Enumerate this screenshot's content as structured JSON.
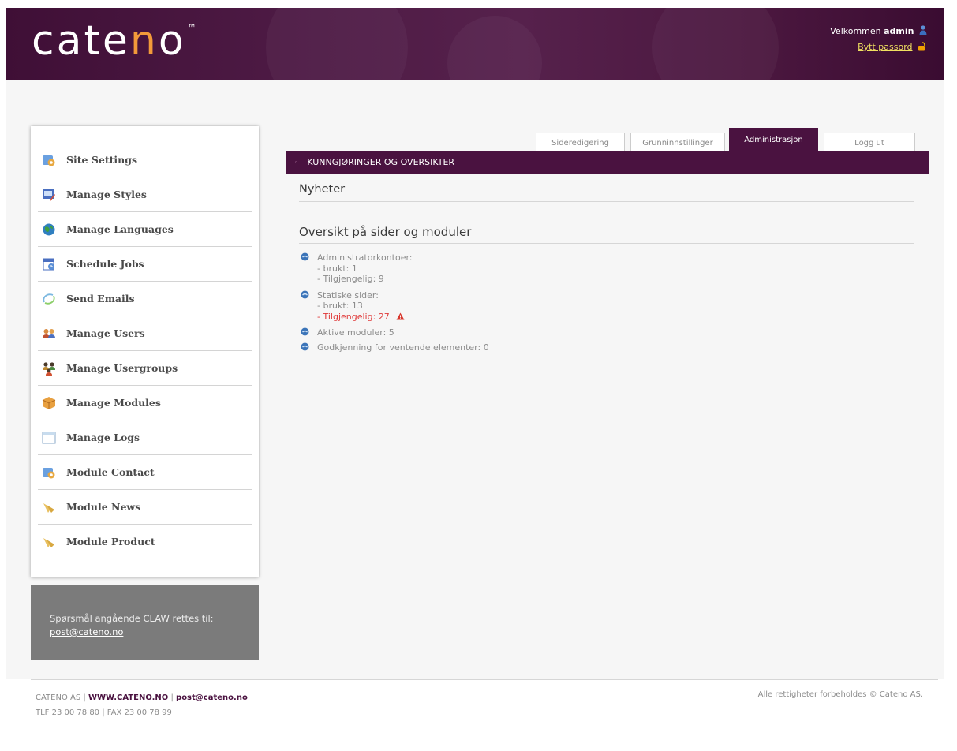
{
  "header": {
    "logo_text": "cateno",
    "logo_tm": "™",
    "welcome_prefix": "Velkommen",
    "username": "admin",
    "change_password": "Bytt passord"
  },
  "sidebar": {
    "items": [
      {
        "label": "Site Settings",
        "icon": "site-settings-icon"
      },
      {
        "label": "Manage Styles",
        "icon": "styles-icon"
      },
      {
        "label": "Manage Languages",
        "icon": "globe-icon"
      },
      {
        "label": "Schedule Jobs",
        "icon": "schedule-icon"
      },
      {
        "label": "Send Emails",
        "icon": "email-icon"
      },
      {
        "label": "Manage Users",
        "icon": "users-icon"
      },
      {
        "label": "Manage Usergroups",
        "icon": "usergroups-icon"
      },
      {
        "label": "Manage Modules",
        "icon": "modules-icon"
      },
      {
        "label": "Manage Logs",
        "icon": "logs-icon"
      },
      {
        "label": "Module Contact",
        "icon": "contact-icon"
      },
      {
        "label": "Module News",
        "icon": "news-icon"
      },
      {
        "label": "Module Product",
        "icon": "product-icon"
      }
    ]
  },
  "info_box": {
    "text": "Spørsmål angående CLAW rettes til:",
    "email": "post@cateno.no"
  },
  "tabs": [
    {
      "label": "Sideredigering",
      "active": false
    },
    {
      "label": "Grunninnstillinger",
      "active": false
    },
    {
      "label": "Administrasjon",
      "active": true
    },
    {
      "label": "Logg ut",
      "active": false
    }
  ],
  "main": {
    "section_title": "KUNNGJØRINGER OG OVERSIKTER",
    "news_heading": "Nyheter",
    "overview_heading": "Oversikt på sider og moduler",
    "stats": [
      {
        "title": "Administratorkontoer:",
        "used": "- brukt: 1",
        "available": "- Tilgjengelig: 9",
        "warning": false
      },
      {
        "title": "Statiske sider:",
        "used": "- brukt: 13",
        "available": "- Tilgjengelig: 27",
        "warning": true
      },
      {
        "title": "Aktive moduler: 5"
      },
      {
        "title": "Godkjenning for ventende elementer: 0"
      }
    ]
  },
  "footer": {
    "company": "CATENO AS",
    "website": "WWW.CATENO.NO",
    "email": "post@cateno.no",
    "contact": "TLF 23 00 78 80 | FAX 23 00 78 99",
    "rights": "Alle rettigheter forbeholdes © Cateno AS."
  },
  "colors": {
    "brand_purple": "#4a1240",
    "logo_accent": "#f29a3a",
    "warning_red": "#e03a3a"
  }
}
